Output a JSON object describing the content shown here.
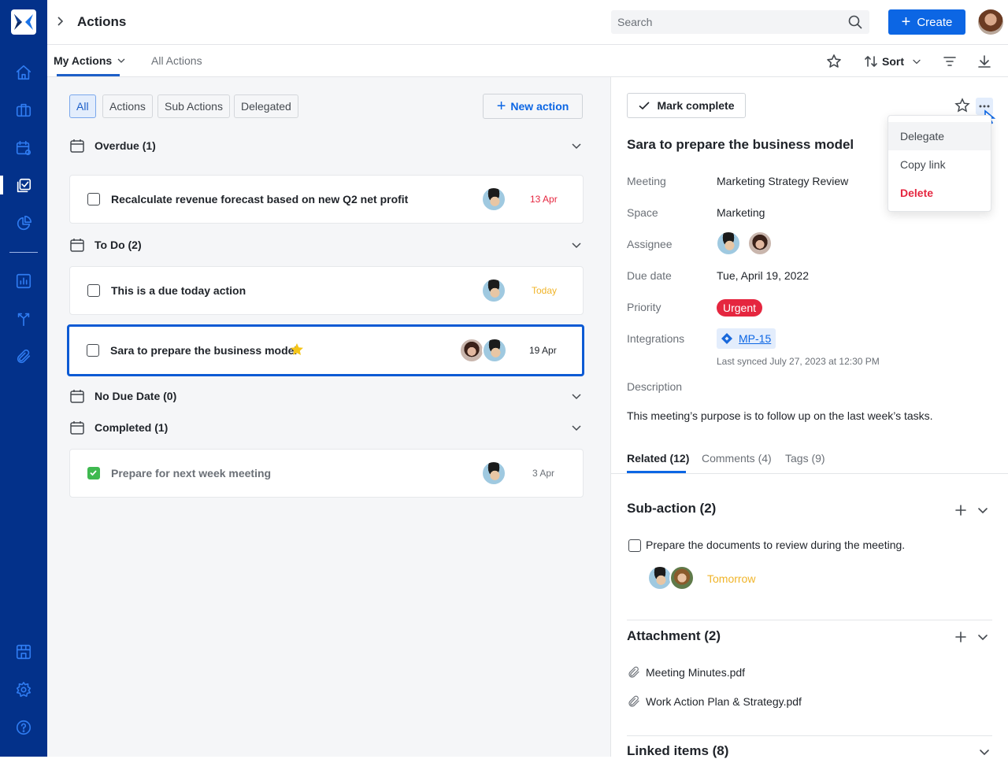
{
  "app": {
    "brand_color": "#03318a",
    "accent_color": "#0c66e4"
  },
  "sidebar": {
    "items": [
      {
        "icon": "home-icon",
        "active": false
      },
      {
        "icon": "briefcase-icon",
        "active": false
      },
      {
        "icon": "calendar-icon",
        "active": false
      },
      {
        "icon": "actions-checklist-icon",
        "active": true
      },
      {
        "icon": "pie-chart-icon",
        "active": false
      },
      {
        "icon": "bar-chart-icon",
        "active": false
      },
      {
        "icon": "branch-icon",
        "active": false
      },
      {
        "icon": "paperclip-icon",
        "active": false
      }
    ],
    "bottom_items": [
      {
        "icon": "store-icon"
      },
      {
        "icon": "settings-gear-icon"
      },
      {
        "icon": "help-icon"
      }
    ]
  },
  "header": {
    "title": "Actions",
    "search_placeholder": "Search",
    "create_label": "Create"
  },
  "subnav": {
    "tabs": [
      {
        "label": "My Actions",
        "active": true
      },
      {
        "label": "All Actions",
        "active": false
      }
    ],
    "sort_label": "Sort"
  },
  "filters": {
    "chips": [
      "All",
      "Actions",
      "Sub Actions",
      "Delegated"
    ],
    "active": "All",
    "new_action_label": "New action"
  },
  "groups": [
    {
      "title": "Overdue (1)",
      "items": [
        {
          "title": "Recalculate revenue forecast based on new Q2 net profit",
          "date": "13 Apr",
          "date_color": "#e5263f",
          "checked": false
        }
      ]
    },
    {
      "title": "To Do (2)",
      "items": [
        {
          "title": "This is a due today action",
          "date": "Today",
          "date_color": "#f0b429",
          "checked": false
        },
        {
          "title": "Sara to prepare the business model",
          "date": "19 Apr",
          "date_color": "#1f2329",
          "checked": false,
          "starred": true,
          "selected": true
        }
      ]
    },
    {
      "title": "No Due Date (0)",
      "items": []
    },
    {
      "title": "Completed (1)",
      "items": [
        {
          "title": "Prepare for next week meeting",
          "date": "3 Apr",
          "date_color": "#6b7077",
          "checked": true
        }
      ]
    }
  ],
  "detail": {
    "mark_complete_label": "Mark complete",
    "title": "Sara to prepare the business model",
    "fields": {
      "meeting_label": "Meeting",
      "meeting_value": "Marketing Strategy Review",
      "space_label": "Space",
      "space_value": "Marketing",
      "assignee_label": "Assignee",
      "due_label": "Due date",
      "due_value": "Tue, April 19, 2022",
      "priority_label": "Priority",
      "priority_value": "Urgent",
      "integrations_label": "Integrations",
      "integration_value": "MP-15",
      "last_synced": "Last synced July 27, 2023 at 12:30 PM",
      "description_label": "Description",
      "description_value": "This meeting’s purpose is to follow up on the last week’s tasks."
    },
    "tabs": [
      {
        "label": "Related (12)",
        "active": true
      },
      {
        "label": "Comments (4)",
        "active": false
      },
      {
        "label": "Tags (9)",
        "active": false
      }
    ],
    "sub_action": {
      "title": "Sub-action (2)",
      "item_text": "Prepare the documents to review during the meeting.",
      "item_due": "Tomorrow"
    },
    "attachment": {
      "title": "Attachment (2)",
      "files": [
        "Meeting Minutes.pdf",
        "Work Action Plan & Strategy.pdf"
      ]
    },
    "linked": {
      "title": "Linked items (8)"
    }
  },
  "context_menu": {
    "items": [
      {
        "label": "Delegate",
        "hover": true
      },
      {
        "label": "Copy link",
        "hover": false
      },
      {
        "label": "Delete",
        "danger": true
      }
    ]
  }
}
